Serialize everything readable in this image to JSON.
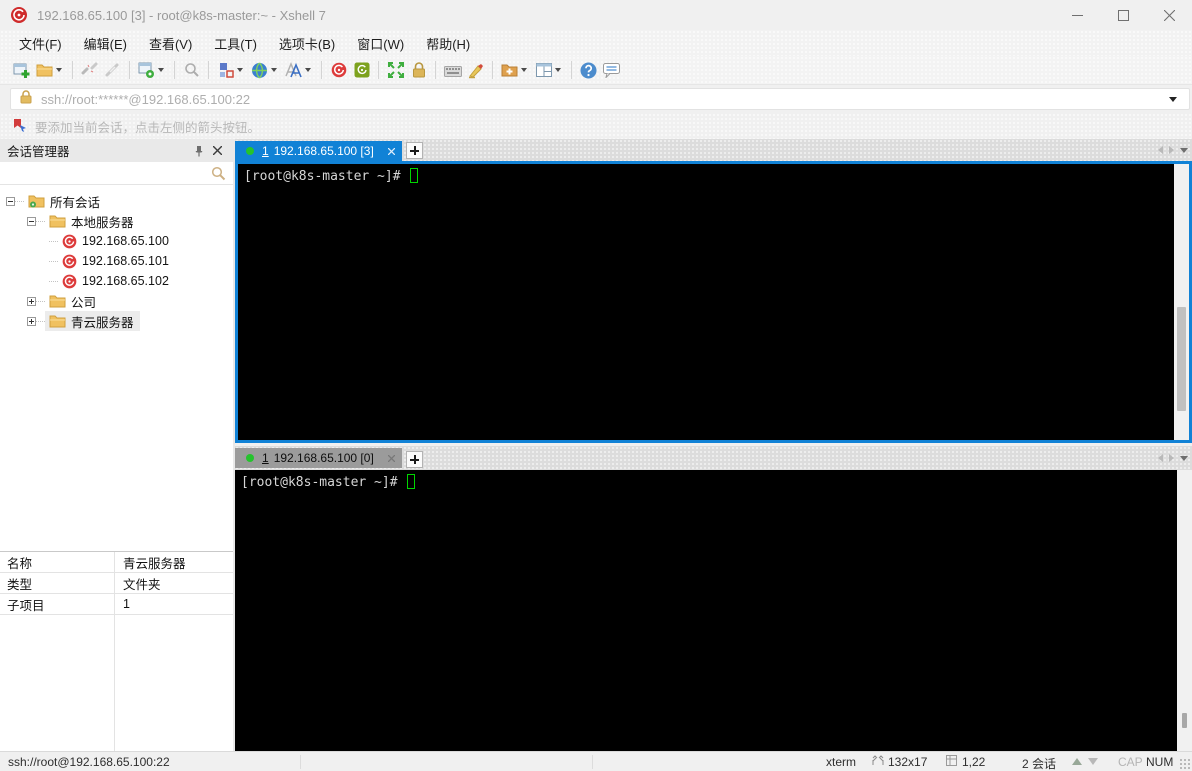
{
  "window": {
    "title": "192.168.65.100 [3] - root@k8s-master:~ - Xshell 7"
  },
  "menubar": {
    "items": [
      {
        "label": "文件(F)"
      },
      {
        "label": "编辑(E)"
      },
      {
        "label": "查看(V)"
      },
      {
        "label": "工具(T)"
      },
      {
        "label": "选项卡(B)"
      },
      {
        "label": "窗口(W)"
      },
      {
        "label": "帮助(H)"
      }
    ]
  },
  "toolbar": {
    "icons": [
      "new-session",
      "open-session",
      "disconnect",
      "reconnect",
      "session-properties",
      "find",
      "compose-bar",
      "encoding-globe",
      "font",
      "xshell",
      "xftp",
      "fullscreen",
      "lock-screen",
      "virtual-keyboard",
      "highlight",
      "new-file",
      "tile-layout",
      "help",
      "feedback"
    ]
  },
  "addressbar": {
    "value": "ssh://root:******@192.168.65.100:22"
  },
  "infobar": {
    "message": "要添加当前会话，点击左侧的箭头按钮。"
  },
  "session_manager": {
    "title": "会话管理器",
    "search": {
      "value": "",
      "placeholder": ""
    },
    "tree": [
      {
        "label": "所有会话"
      },
      {
        "label": "本地服务器"
      },
      {
        "label": "192.168.65.100"
      },
      {
        "label": "192.168.65.101"
      },
      {
        "label": "192.168.65.102"
      },
      {
        "label": "公司"
      },
      {
        "label": "青云服务器"
      }
    ],
    "properties": {
      "rows": [
        {
          "label": "名称",
          "value": "青云服务器"
        },
        {
          "label": "类型",
          "value": "文件夹"
        },
        {
          "label": "子项目",
          "value": "1"
        }
      ]
    }
  },
  "panes": [
    {
      "tab": {
        "index": "1",
        "title": "192.168.65.100 [3]"
      },
      "terminal": {
        "prompt": "[root@k8s-master ~]# "
      }
    },
    {
      "tab": {
        "index": "1",
        "title": "192.168.65.100 [0]"
      },
      "terminal": {
        "prompt": "[root@k8s-master ~]# "
      }
    }
  ],
  "statusbar": {
    "left": "ssh://root@192.168.65.100:22",
    "terminal_type": "xterm",
    "size": "132x17",
    "cursor_pos": "1,22",
    "sessions": "2 会话",
    "cap": "CAP",
    "num": "NUM"
  },
  "colors": {
    "accent_blue": "#1182d6",
    "tab_green_dot": "#25c32d",
    "terminal_cursor_green": "#00d500",
    "session_icon_red": "#dd3b3b",
    "folder_gold": "#f5c85c"
  }
}
